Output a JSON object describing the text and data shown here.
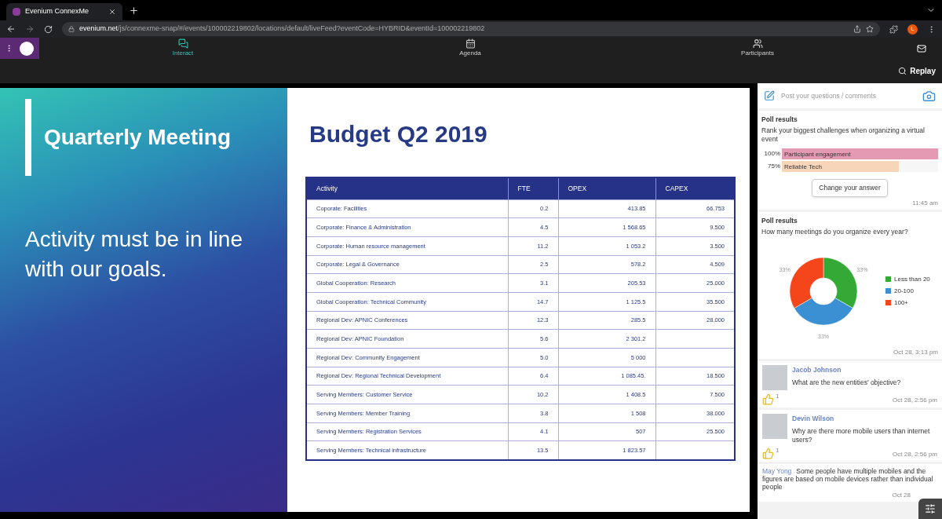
{
  "browser": {
    "tab_title": "Evenium ConnexMe",
    "url_host": "evenium.net",
    "url_path": "/js/connexme-snap/#/events/100002219802/locations/default/liveFeed?eventCode=HYBRID&eventId=100002219802",
    "profile_initial": "L"
  },
  "nav": {
    "items": [
      {
        "kind": "chat",
        "label": "Interact",
        "selected": true
      },
      {
        "kind": "calendar",
        "label": "Agenda",
        "selected": false
      },
      {
        "kind": "people",
        "label": "Participants",
        "selected": false
      }
    ]
  },
  "replay": "Replay",
  "slide": {
    "heading": "Quarterly Meeting",
    "statement": "Activity must be in line with our goals.",
    "title": "Budget Q2 2019",
    "table": {
      "columns": [
        "Activity",
        "FTE",
        "OPEX",
        "CAPEX"
      ],
      "rows": [
        [
          "Coporate: Facilities",
          "0.2",
          "413.85",
          "66.753"
        ],
        [
          "Corporate: Finance & Administration",
          "4.5",
          "1 568.65",
          "9.500"
        ],
        [
          "Corporate: Human resource management",
          "11.2",
          "1 053.2",
          "3.500"
        ],
        [
          "Corporate: Legal & Governance",
          "2.5",
          "578.2",
          "4.509"
        ],
        [
          "Global Cooperation: Research",
          "3.1",
          "205.53",
          "25.000"
        ],
        [
          "Global Cooperation: Technical Community",
          "14.7",
          "1 125.5",
          "35.500"
        ],
        [
          "Regional Dev: APNIC Conferences",
          "12.3",
          "285.5",
          "28.000"
        ],
        [
          "Regional Dev: APNIC Foundation",
          "5.6",
          "2 301.2",
          ""
        ],
        [
          "Regional Dev: Community Engagement",
          "5.0",
          "5 000",
          ""
        ],
        [
          "Regional Dev: Regional Technical Development",
          "6.4",
          "1 085.45.",
          "18.500"
        ],
        [
          "Serving Members: Customer Service",
          "10.2",
          "1 408.5",
          "7.500"
        ],
        [
          "Serving Members: Member Training",
          "3.8",
          "1 508",
          "38.000"
        ],
        [
          "Serving Members: Registration Services",
          "4.1",
          "507",
          "25.500"
        ],
        [
          "Serving Members: Technical infrastructure",
          "13.5",
          "1 823.57",
          ""
        ]
      ]
    }
  },
  "sidebar": {
    "post_placeholder": "Post your questions / comments",
    "polls": [
      {
        "kind": "bars",
        "title": "Poll results",
        "question": "Rank your biggest challenges when organizing a virtual event",
        "options": [
          {
            "percent": "100%",
            "label": "Participant engagement",
            "level": 1,
            "color": "#e59ab3"
          },
          {
            "percent": "75%",
            "label": "Reliable Tech",
            "level": 0.75,
            "color": "#f7d5b9"
          }
        ],
        "button": "Change your answer",
        "time": "11:45 am"
      },
      {
        "kind": "donut",
        "title": "Poll results",
        "question": "How many meetings do you organize every year?",
        "chart_data": {
          "type": "donut",
          "categories": [
            "Less than 20",
            "20-100",
            "100+"
          ],
          "values": [
            33,
            33,
            33
          ],
          "legend": "right",
          "colors": [
            "#35a936",
            "#3b8fd3",
            "#f5451a"
          ],
          "value_labels": [
            "33%",
            "33%",
            "33%"
          ]
        },
        "time": "Oct 28, 3:13 pm"
      }
    ],
    "comments": [
      {
        "kind": "question",
        "author": "Jacob Johnson",
        "text": "What are the new entities' objective?",
        "likes": "1",
        "time": "Oct 28, 2:56 pm"
      },
      {
        "kind": "question",
        "author": "Devin Wilson",
        "text": "Why are there more mobile users than internet users?",
        "likes": "1",
        "time": "Oct 28, 2:56 pm"
      },
      {
        "kind": "reply",
        "author": "May Yong",
        "text": "Some people have multiple mobiles and the figures are based on mobile devices rather than individual people",
        "time": "Oct 28"
      }
    ]
  }
}
